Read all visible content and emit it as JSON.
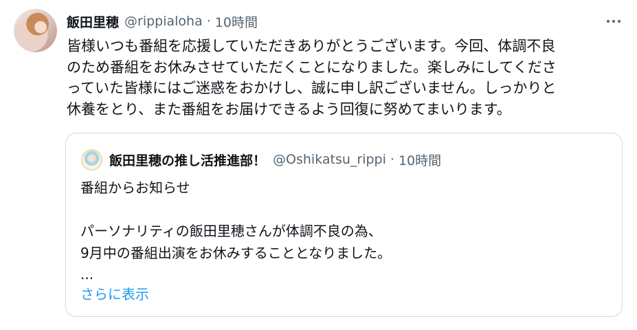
{
  "tweet": {
    "author": {
      "display_name": "飯田里穂",
      "handle": "@rippialoha",
      "separator": "·",
      "timestamp": "10時間"
    },
    "menu_icon": "more-horizontal-icon",
    "body_lines": [
      "皆様いつも番組を応援していただきありがとうございます。今回、体調不良",
      "のため番組をお休みさせていただくことになりました。楽しみにしてくださ",
      "っていた皆様にはご迷惑をおかけし、誠に申し訳ございません。しっかりと",
      "休養をとり、また番組をお届けできるよう回復に努めてまいります。"
    ]
  },
  "quote": {
    "author": {
      "display_name": "飯田里穂の推し活推進部！",
      "handle": "@Oshikatsu_rippi",
      "separator": "·",
      "timestamp": "10時間"
    },
    "lines": [
      "番組からお知らせ",
      "",
      "パーソナリティの飯田里穂さんが体調不良の為、",
      "9月中の番組出演をお休みすることとなりました。",
      "..."
    ],
    "show_more_label": "さらに表示"
  },
  "colors": {
    "text": "#0f1419",
    "secondary": "#536471",
    "link": "#1d9bf0",
    "border": "#cfd9de"
  }
}
